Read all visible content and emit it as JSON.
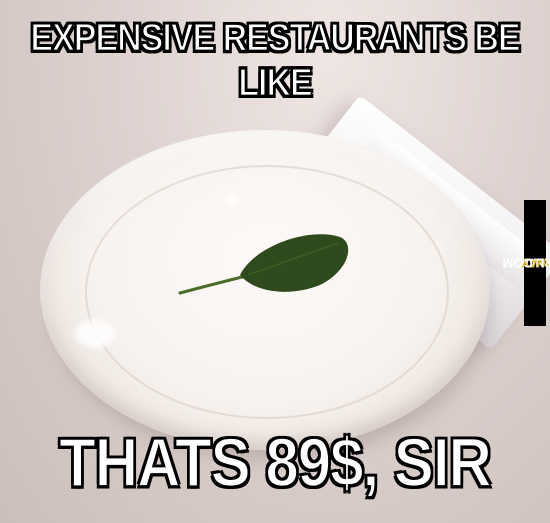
{
  "captions": {
    "top": "EXPENSIVE RESTAURANTS BE LIKE",
    "bottom": "THATS 89$, SIR"
  },
  "watermark": {
    "part1": "NO",
    "part2": "WAY",
    "part3": "GIRL.COM"
  },
  "colors": {
    "caption_text": "#ffffff",
    "caption_outline": "#000000",
    "leaf": "#2f4a1c",
    "plate": "#f6f1ed"
  }
}
